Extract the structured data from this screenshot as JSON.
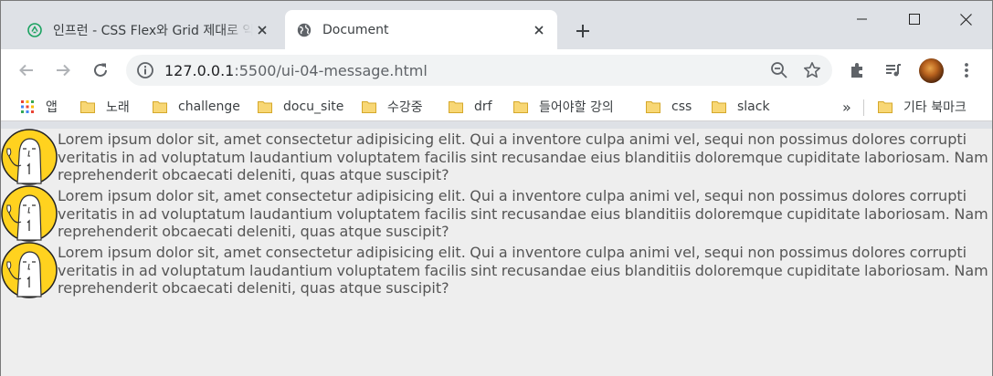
{
  "tabs": [
    {
      "title": "인프런 - CSS Flex와 Grid 제대로 익히기",
      "active": false,
      "favicon": "inflearn-icon"
    },
    {
      "title": "Document",
      "active": true,
      "favicon": "globe-icon"
    }
  ],
  "toolbar": {
    "url_host": "127.0.0.1",
    "url_rest": ":5500/ui-04-message.html"
  },
  "bookmarks": {
    "apps_label": "앱",
    "items": [
      "노래",
      "challenge",
      "docu_site",
      "수강중",
      "drf",
      "들어야할 강의",
      "css",
      "slack"
    ],
    "overflow": "»",
    "other": "기타 북마크"
  },
  "messages": [
    {
      "avatar": "cartoon-avatar",
      "text": "Lorem ipsum dolor sit, amet consectetur adipisicing elit. Qui a inventore culpa animi vel, sequi non possimus dolores corrupti veritatis in ad voluptatum laudantium voluptatem facilis sint recusandae eius blanditiis doloremque cupiditate laboriosam. Nam reprehenderit obcaecati deleniti, quas atque suscipit?"
    },
    {
      "avatar": "cartoon-avatar",
      "text": "Lorem ipsum dolor sit, amet consectetur adipisicing elit. Qui a inventore culpa animi vel, sequi non possimus dolores corrupti veritatis in ad voluptatum laudantium voluptatem facilis sint recusandae eius blanditiis doloremque cupiditate laboriosam. Nam reprehenderit obcaecati deleniti, quas atque suscipit?"
    },
    {
      "avatar": "cartoon-avatar",
      "text": "Lorem ipsum dolor sit, amet consectetur adipisicing elit. Qui a inventore culpa animi vel, sequi non possimus dolores corrupti veritatis in ad voluptatum laudantium voluptatem facilis sint recusandae eius blanditiis doloremque cupiditate laboriosam. Nam reprehenderit obcaecati deleniti, quas atque suscipit?"
    }
  ]
}
